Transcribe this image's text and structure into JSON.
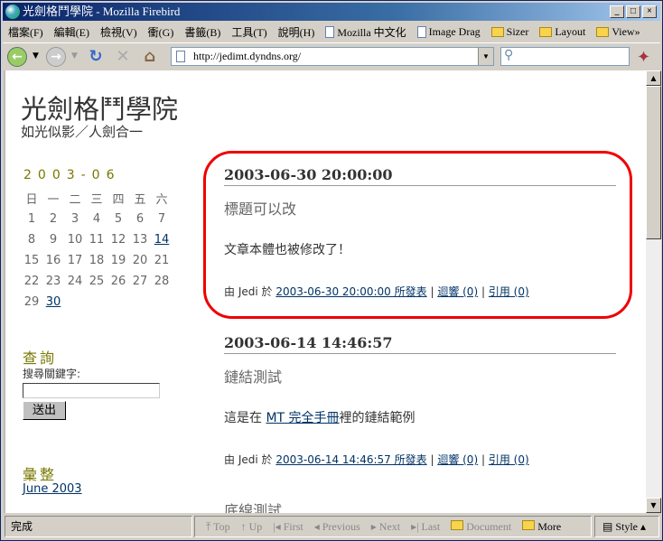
{
  "window": {
    "title": "光劍格鬥學院 - Mozilla Firebird",
    "min": "_",
    "max": "□",
    "close": "×"
  },
  "menu": [
    "檔案(F)",
    "編輯(E)",
    "檢視(V)",
    "衝(G)",
    "書籤(B)",
    "工具(T)",
    "說明(H)"
  ],
  "bookmarks": [
    {
      "label": "Mozilla 中文化",
      "icon": "page-icon"
    },
    {
      "label": "Image Drag",
      "icon": "page-icon"
    },
    {
      "label": "Sizer",
      "icon": "folder-icon"
    },
    {
      "label": "Layout",
      "icon": "folder-icon"
    },
    {
      "label": "View»",
      "icon": "folder-icon"
    }
  ],
  "nav": {
    "url": "http://jedimt.dyndns.org/",
    "search_placeholder": ""
  },
  "site": {
    "title": "光劍格鬥學院",
    "subtitle": "如光似影／人劍合一"
  },
  "calendar": {
    "month": "2003-06",
    "weekdays": [
      "日",
      "一",
      "二",
      "三",
      "四",
      "五",
      "六"
    ],
    "weeks": [
      [
        "1",
        "2",
        "3",
        "4",
        "5",
        "6",
        "7"
      ],
      [
        "8",
        "9",
        "10",
        "11",
        "12",
        "13",
        "14"
      ],
      [
        "15",
        "16",
        "17",
        "18",
        "19",
        "20",
        "21"
      ],
      [
        "22",
        "23",
        "24",
        "25",
        "26",
        "27",
        "28"
      ],
      [
        "29",
        "30",
        "",
        "",
        "",
        "",
        ""
      ]
    ],
    "linked_days": [
      "14",
      "30"
    ]
  },
  "search": {
    "heading": "查詢",
    "label": "搜尋關鍵字:",
    "value": "",
    "button": "送出"
  },
  "archive": {
    "heading": "彙整",
    "items": [
      "June 2003"
    ]
  },
  "posts": [
    {
      "date": "2003-06-30 20:00:00",
      "title": "標題可以改",
      "body": "文章本體也被修改了！",
      "by": "由 Jedi 於",
      "permalink": "2003-06-30 20:00:00 所發表",
      "comments": "迴響 (0)",
      "trackback": "引用 (0)",
      "highlighted": true
    },
    {
      "date": "2003-06-14 14:46:57",
      "title": "鏈結測試",
      "body_pre": "這是在 ",
      "body_link": "MT 完全手冊",
      "body_post": "裡的鏈結範例",
      "by": "由 Jedi 於",
      "permalink": "2003-06-14 14:46:57 所發表",
      "comments": "迴響 (0)",
      "trackback": "引用 (0)"
    },
    {
      "title": "底線測試"
    }
  ],
  "sep": "|",
  "status": {
    "text": "完成",
    "nav": [
      "Top",
      "Up",
      "First",
      "Previous",
      "Next",
      "Last",
      "Document",
      "More"
    ],
    "style": "Style ▴"
  },
  "colors": {
    "highlight": "#ee0000",
    "link": "#003366",
    "sidebar_heading": "#777700"
  }
}
